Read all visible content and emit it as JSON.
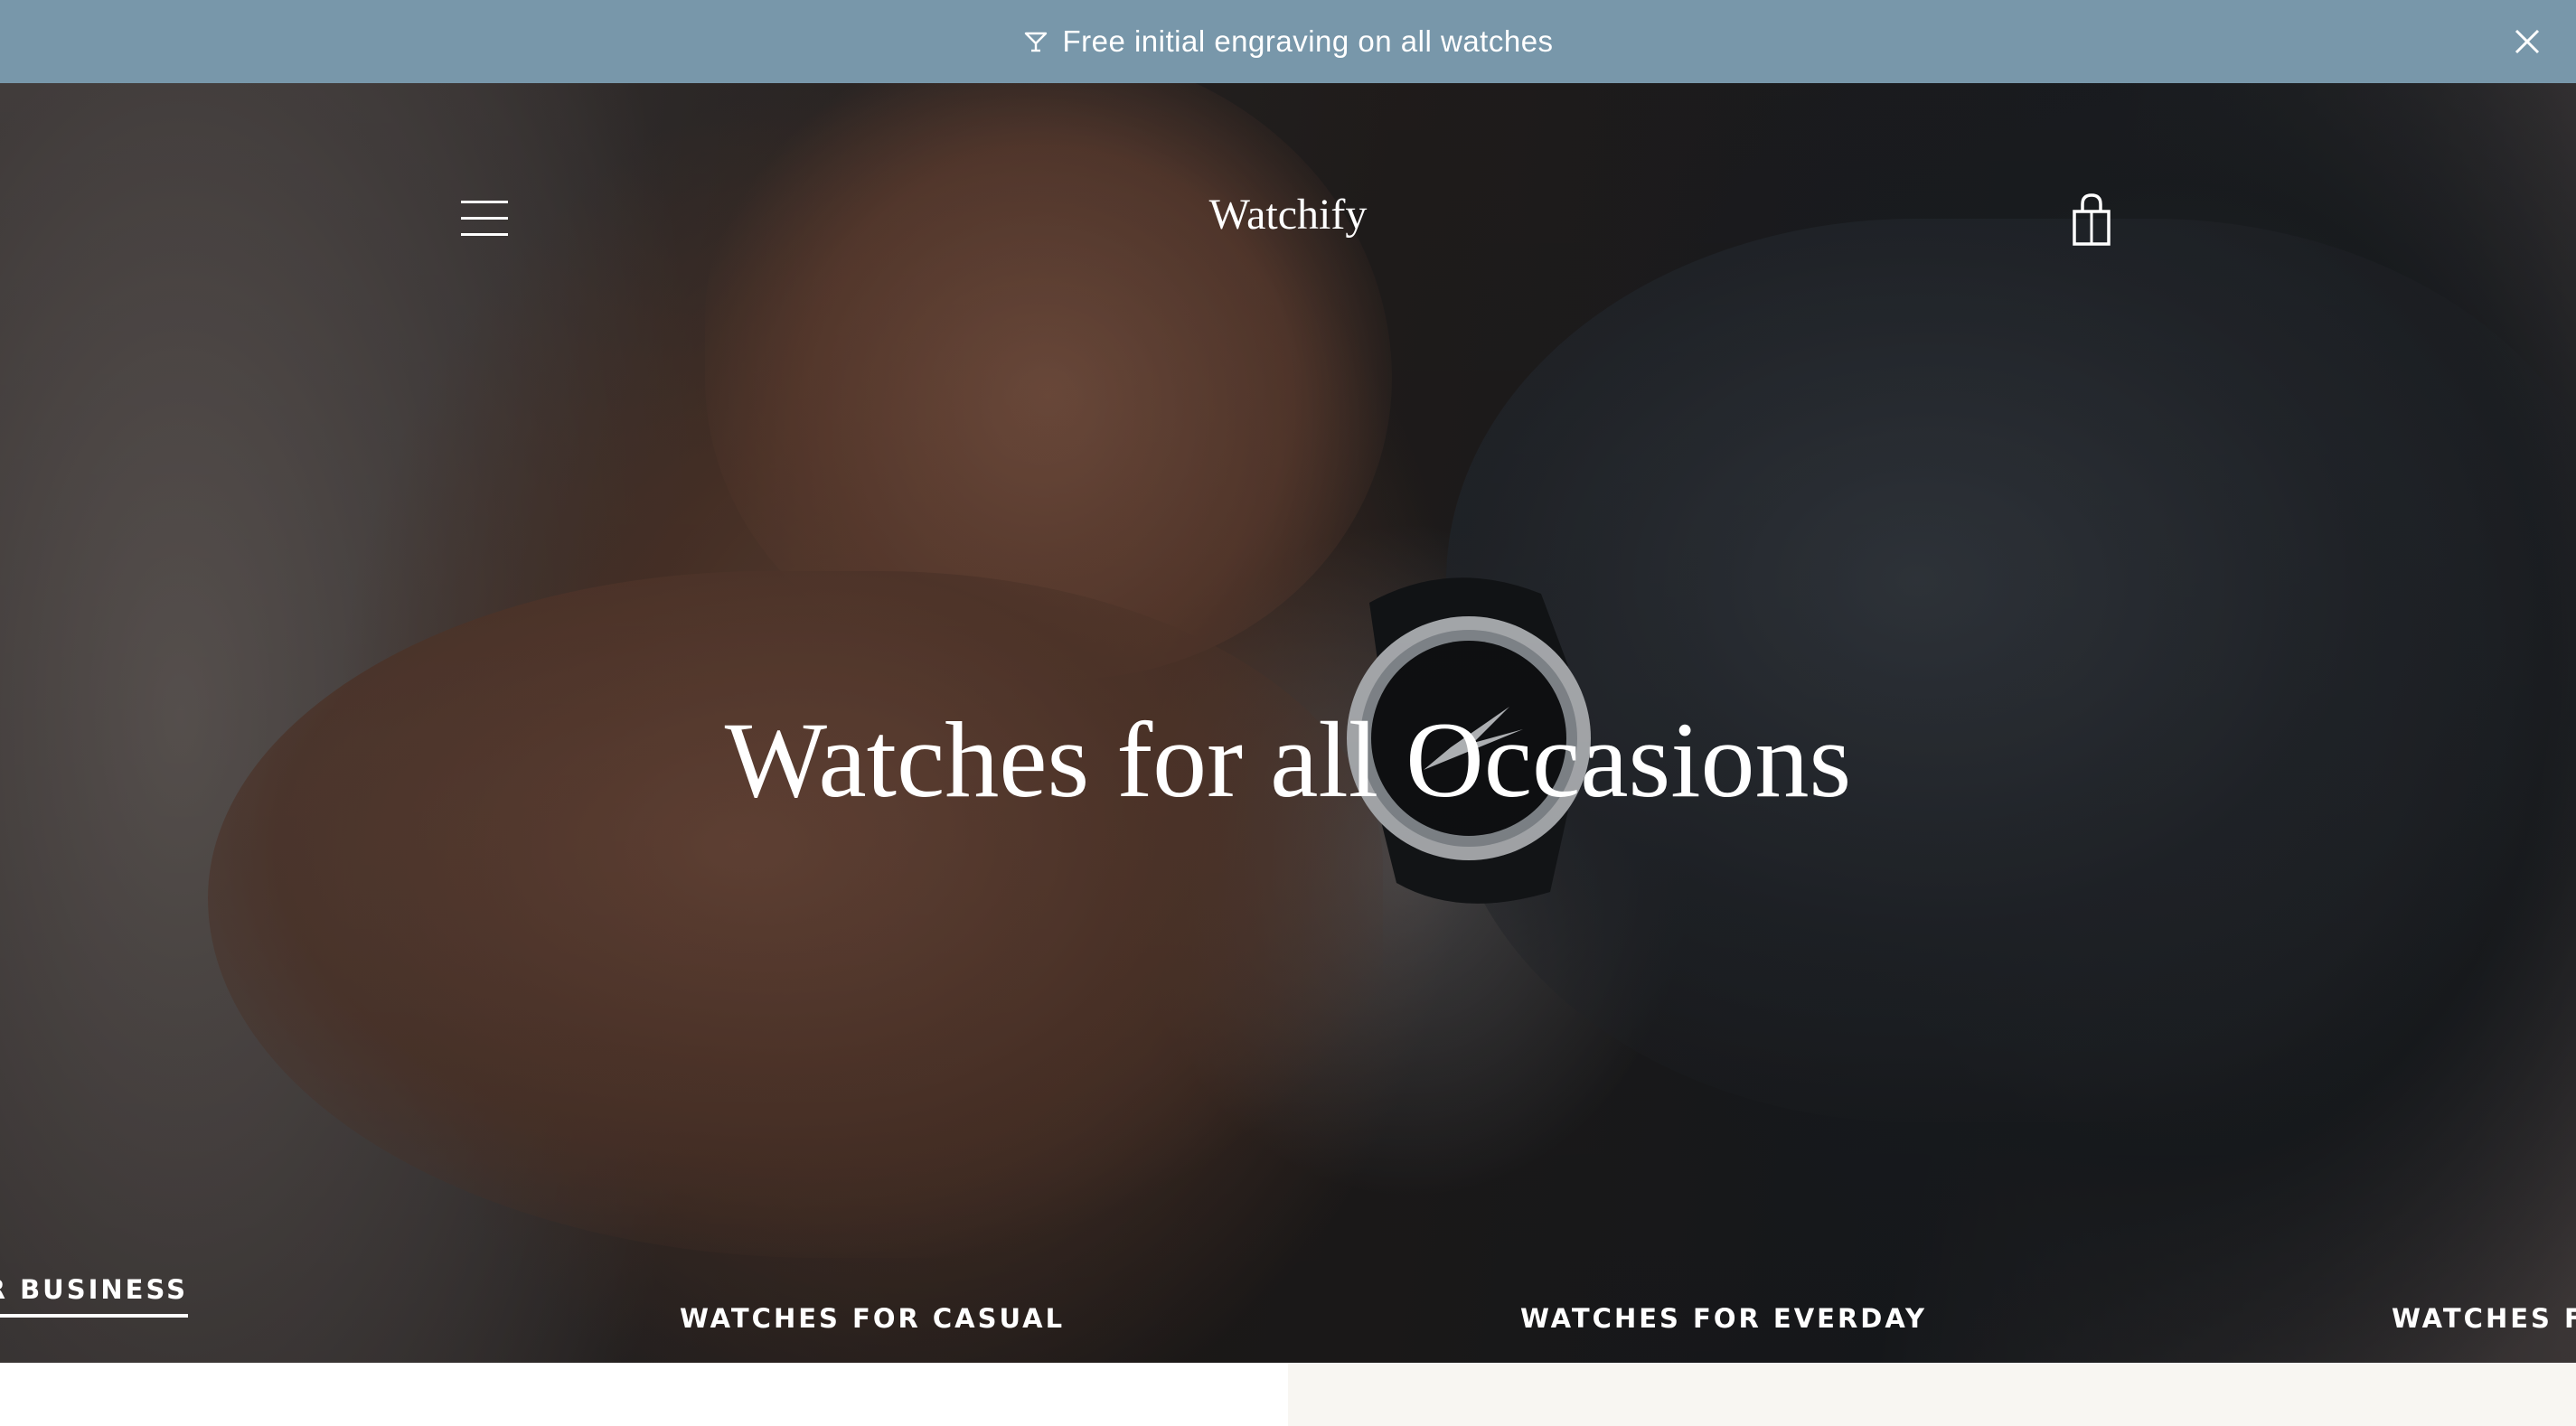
{
  "announcement": {
    "text": "Free initial engraving on all watches",
    "icon": "martini-glass-icon",
    "close_icon": "close-icon",
    "background": "#7897aa"
  },
  "header": {
    "logo": "Watchify",
    "menu_icon": "hamburger-menu-icon",
    "cart_icon": "shopping-bag-icon"
  },
  "hero": {
    "title": "Watches for all Occasions"
  },
  "collections": [
    {
      "label": "OR BUSINESS",
      "active": true
    },
    {
      "label": "WATCHES FOR CASUAL",
      "active": false
    },
    {
      "label": "WATCHES FOR EVERDAY",
      "active": false
    },
    {
      "label": "WATCHES FO",
      "active": false
    }
  ]
}
